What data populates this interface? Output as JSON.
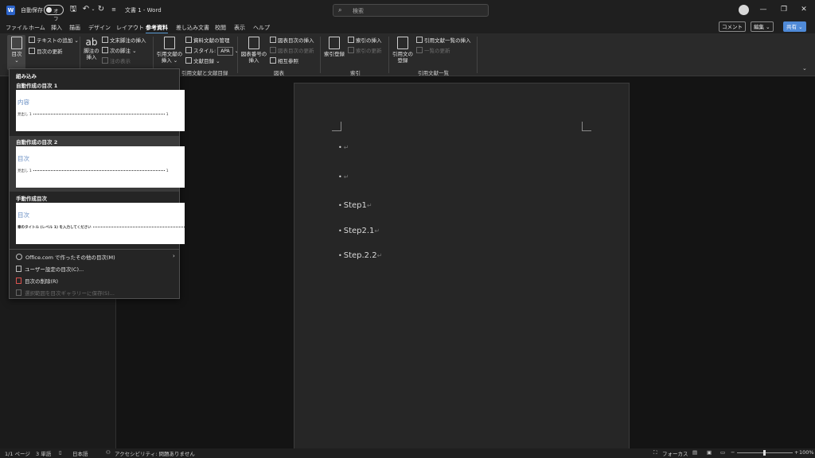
{
  "titlebar": {
    "autosave_label": "自動保存",
    "autosave_state": "オフ",
    "doc_title": "文書 1  -  Word",
    "search_placeholder": "検索",
    "minimize": "—",
    "restore": "❐",
    "close": "✕"
  },
  "tabs": [
    "ファイル",
    "ホーム",
    "挿入",
    "描画",
    "デザイン",
    "レイアウト",
    "参考資料",
    "差し込み文書",
    "校閲",
    "表示",
    "ヘルプ"
  ],
  "active_tab": "参考資料",
  "top_buttons": {
    "comment": "コメント",
    "edit": "編集 ⌄",
    "share": "共有 ⌄"
  },
  "ribbon": {
    "toc": {
      "toc_button": "目次",
      "add_text": "テキストの追加 ⌄",
      "update_toc": "目次の更新"
    },
    "footnotes": {
      "insert_footnote": "脚注の挿入",
      "insert_endnote": "文末脚注の挿入",
      "next_footnote": "次の脚注",
      "show_notes": "注の表示"
    },
    "citations": {
      "insert_citation": "引用文献の挿入",
      "manage_sources": "資料文献の管理",
      "style_label": "スタイル:",
      "style_value": "APA",
      "bibliography": "文献目録 ⌄",
      "group_label": "引用文献と文献目録"
    },
    "captions": {
      "insert_caption": "図表番号の挿入",
      "insert_table_of_figures": "図表目次の挿入",
      "update_table": "図表目次の更新",
      "cross_reference": "相互参照",
      "group_label": "図表"
    },
    "index": {
      "mark_entry": "索引登録",
      "insert_index": "索引の挿入",
      "update_index": "索引の更新",
      "group_label": "索引"
    },
    "toa": {
      "mark_citation": "引用文の登録",
      "insert_toa": "引用文献一覧の挿入",
      "update_toa": "一覧の更新",
      "group_label": "引用文献一覧"
    }
  },
  "dropdown": {
    "builtin_header": "組み込み",
    "sections": [
      {
        "title": "自動作成の目次 1",
        "thumb_heading": "内容",
        "line1": "見出し 1",
        "line1_page": "1"
      },
      {
        "title": "自動作成の目次 2",
        "thumb_heading": "目次",
        "line1": "見出し 1",
        "line1_page": "1"
      },
      {
        "title": "手動作成目次",
        "thumb_heading": "目次",
        "line1": "章のタイトル (レベル 1) を入力してください",
        "line1_page": "1"
      }
    ],
    "items": {
      "more_office": "Office.com で作ったその他の目次(M)",
      "custom_toc": "ユーザー設定の目次(C)...",
      "remove_toc": "目次の削除(R)",
      "save_selection": "選択範囲を目次ギャラリーに保存(S)..."
    }
  },
  "document": {
    "bullets": [
      "",
      "",
      "Step1",
      "Step2.1",
      "Step.2.2"
    ],
    "para_mark": "↵"
  },
  "statusbar": {
    "page": "1/1 ページ",
    "words": "3 単語",
    "language": "日本語",
    "accessibility": "アクセシビリティ: 問題ありません",
    "focus": "フォーカス",
    "zoom": "100%"
  }
}
